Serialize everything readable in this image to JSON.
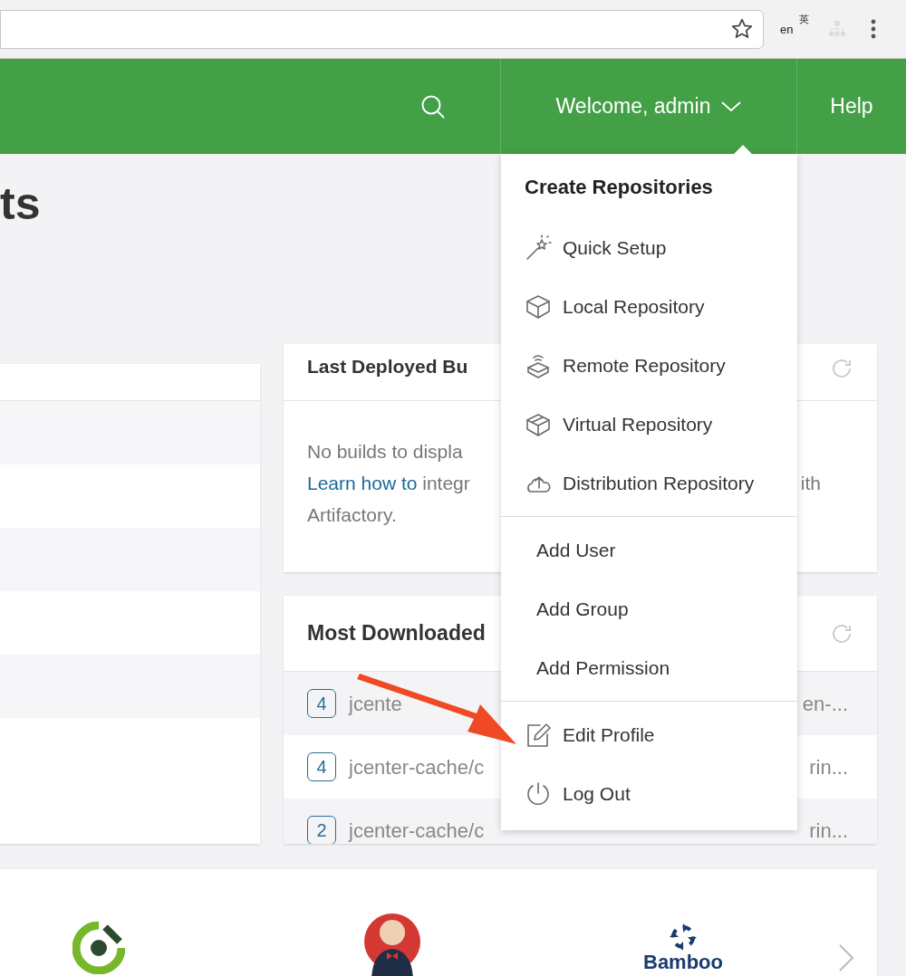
{
  "browser": {
    "extension_label_top": "英",
    "extension_label_bottom": "en"
  },
  "header": {
    "user_menu": "Welcome, admin",
    "help": "Help",
    "user_menu_expanded": true
  },
  "page_title": "ts",
  "last_builds": {
    "title": "Last Deployed Bu",
    "empty_text": "No builds to displa",
    "link": "Learn how to",
    "link_after": "integr",
    "line_end": "ith",
    "line_2": "Artifactory."
  },
  "most_downloaded": {
    "title": "Most Downloaded",
    "rows": [
      {
        "count": "4",
        "path": "jcente",
        "tail": "en-..."
      },
      {
        "count": "4",
        "path": "jcenter-cache/c",
        "tail": "rin..."
      },
      {
        "count": "2",
        "path": "jcenter-cache/c",
        "tail": "rin..."
      }
    ]
  },
  "menu": {
    "heading": "Create Repositories",
    "items": [
      {
        "kind": "wand",
        "label": "Quick Setup"
      },
      {
        "kind": "cube",
        "label": "Local Repository"
      },
      {
        "kind": "remote",
        "label": "Remote Repository"
      },
      {
        "kind": "virtual",
        "label": "Virtual Repository"
      },
      {
        "kind": "cloud",
        "label": "Distribution Repository"
      },
      {
        "kind": "divider"
      },
      {
        "kind": "plain",
        "label": "Add User"
      },
      {
        "kind": "plain",
        "label": "Add Group"
      },
      {
        "kind": "plain",
        "label": "Add Permission"
      },
      {
        "kind": "divider"
      },
      {
        "kind": "edit",
        "label": "Edit Profile"
      },
      {
        "kind": "power",
        "label": "Log Out"
      }
    ]
  },
  "integrations": {
    "bamboo_label": "Bamboo"
  }
}
